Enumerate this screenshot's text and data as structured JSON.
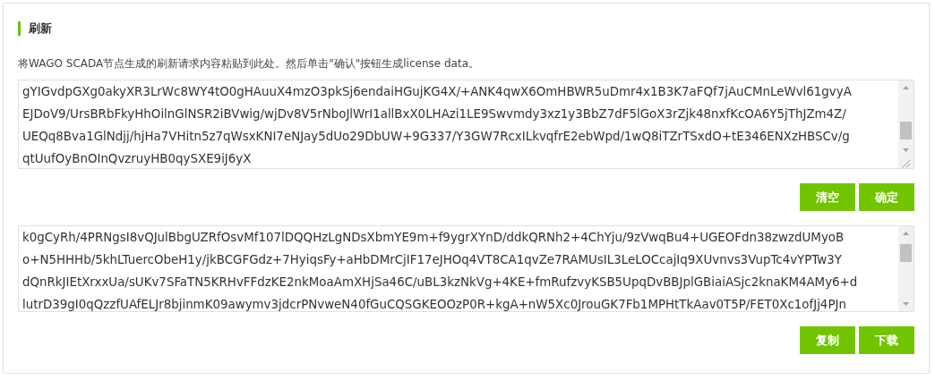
{
  "section": {
    "title": "刷新"
  },
  "instruction": "将WAGO SCADA节点生成的刷新请求内容粘贴到此处。然后单击\"确认\"按钮生成license data。",
  "request_field": {
    "lines": [
      "gYIGvdpGXg0akyXR3LrWc8WY4tO0gHAuuX4mzO3pkSj6endaiHGujKG4X/+ANK4qwX6OmHBWR5uDmr4x1B3K7aFQf7jAuCMnLeWvl61gvyA",
      "EJDoV9/UrsBRbFkyHhOilnGlNSR2iBVwig/wjDv8V5rNboJlWrI1allBxX0LHAzi1LE9Swvmdy3xz1y3BbZ7dF5lGoX3rZjk48nxfKcOA6Y5jThJZm4Z/",
      "UEQq8Bva1GlNdjj/hjHa7VHitn5z7qWsxKNI7eNJay5dUo29DbUW+9G337/Y3GW7RcxILkvqfrE2ebWpd/1wQ8iTZrTSxdO+tE346ENXzHBSCv/g",
      "qtUufOyBnOInQvzruyHB0qySXE9iJ6yX"
    ]
  },
  "request_buttons": [
    {
      "label": "清空"
    },
    {
      "label": "确定"
    }
  ],
  "license_field": {
    "lines": [
      "k0gCyRh/4PRNgsI8vQJulBbgUZRfOsvMf107lDQQHzLgNDsXbmYE9m+f9ygrXYnD/ddkQRNh2+4ChYju/9zVwqBu4+UGEOFdn38zwzdUMyoB",
      "o+N5HHHb/5khLTuercObeH1y/jkBCGFGdz+7HyiqsFy+aHbDMrCjIF17eJHOq4VT8CA1qvZe7RAMUsIL3LeLOCcajIq9XUvnvs3VupTc4vYPTw3Y",
      "dQnRkJIEtXrxxUa/sUKv7SFaTN5KRHvFFdzKE2nkMoaAmXHjSa46C/uBL3kzNkVg+4KE+fmRufzvyKSB5UpqDvBBJplGBiaiASjc2knaKM4AMy6+d",
      "lutrD39gI0qQzzfUAfELJr8bjinmK09awymv3jdcrPNvweN40fGuCQSGKEOOzP0R+kgA+nW5Xc0JrouGK7Fb1MPHtTkAav0T5P/FET0Xc1ofJj4PJn"
    ]
  },
  "license_buttons": [
    {
      "label": "复制"
    },
    {
      "label": "下载"
    }
  ]
}
